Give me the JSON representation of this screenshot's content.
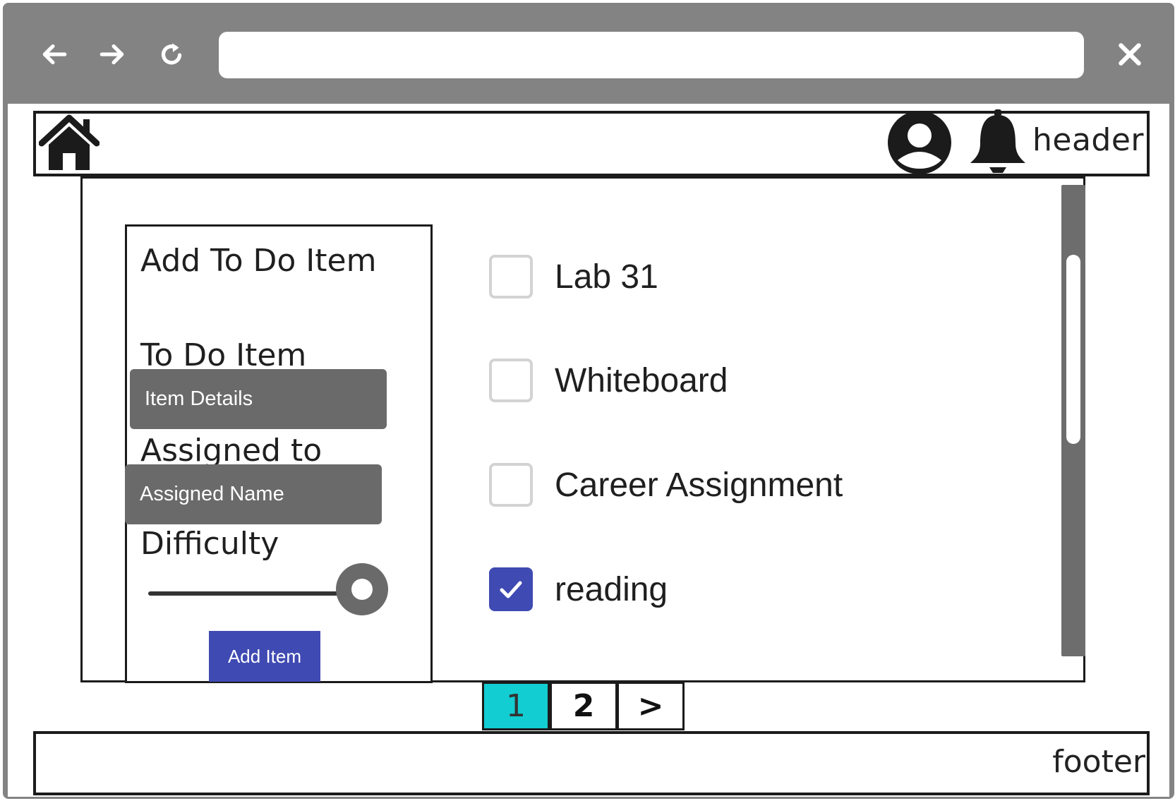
{
  "browser": {
    "back_icon": "arrow-left-icon",
    "forward_icon": "arrow-right-icon",
    "reload_icon": "reload-icon",
    "close_icon": "close-icon",
    "url": ""
  },
  "header": {
    "home_icon": "home-icon",
    "avatar_icon": "user-avatar-icon",
    "bell_icon": "bell-icon",
    "label": "header"
  },
  "form": {
    "title": "Add To Do Item",
    "todo_label": "To Do Item",
    "todo_placeholder": "Item Details",
    "assigned_label": "Assigned to",
    "assigned_placeholder": "Assigned Name",
    "difficulty_label": "Difficulty",
    "difficulty_value": 1.0,
    "submit_label": "Add Item"
  },
  "todos": [
    {
      "label": "Lab 31",
      "checked": false
    },
    {
      "label": "Whiteboard",
      "checked": false
    },
    {
      "label": "Career Assignment",
      "checked": false
    },
    {
      "label": "reading",
      "checked": true
    }
  ],
  "pagination": {
    "pages": [
      "1",
      "2"
    ],
    "current": "1",
    "next_label": ">"
  },
  "footer": {
    "label": "footer"
  },
  "colors": {
    "accent": "#3f4ab2",
    "active_page": "#12cdd2",
    "input_bg": "#6a6a6a",
    "chrome": "#838383"
  }
}
